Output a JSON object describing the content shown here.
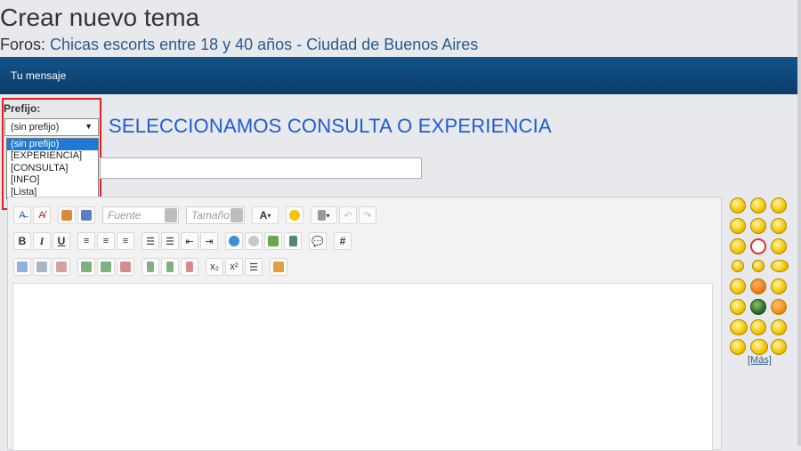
{
  "page": {
    "title": "Crear nuevo tema",
    "forum_prefix": "Foros:",
    "forum_link": "Chicas escorts entre 18 y 40 años - Ciudad de Buenos Aires",
    "section_bar": "Tu mensaje"
  },
  "prefix": {
    "label": "Prefijo:",
    "selected": "(sin prefijo)",
    "options": [
      "(sin prefijo)",
      "[EXPERIENCIA]",
      "[CONSULTA]",
      "[INFO]",
      "[Lista]"
    ]
  },
  "annotation": "SELECCIONAMOS CONSULTA O EXPERIENCIA",
  "editor": {
    "font_label": "Fuente",
    "size_label": "Tamaño",
    "text_color_label": "A",
    "hash_label": "#",
    "subscript_label": "x₂",
    "superscript_label": "x²"
  },
  "smilies": {
    "more_label": "[Más]"
  },
  "colors": {
    "bar": "#0b3d6a",
    "annotation": "#1e5bd6",
    "highlight": "#e02020",
    "option_selected": "#1e7ad8"
  }
}
